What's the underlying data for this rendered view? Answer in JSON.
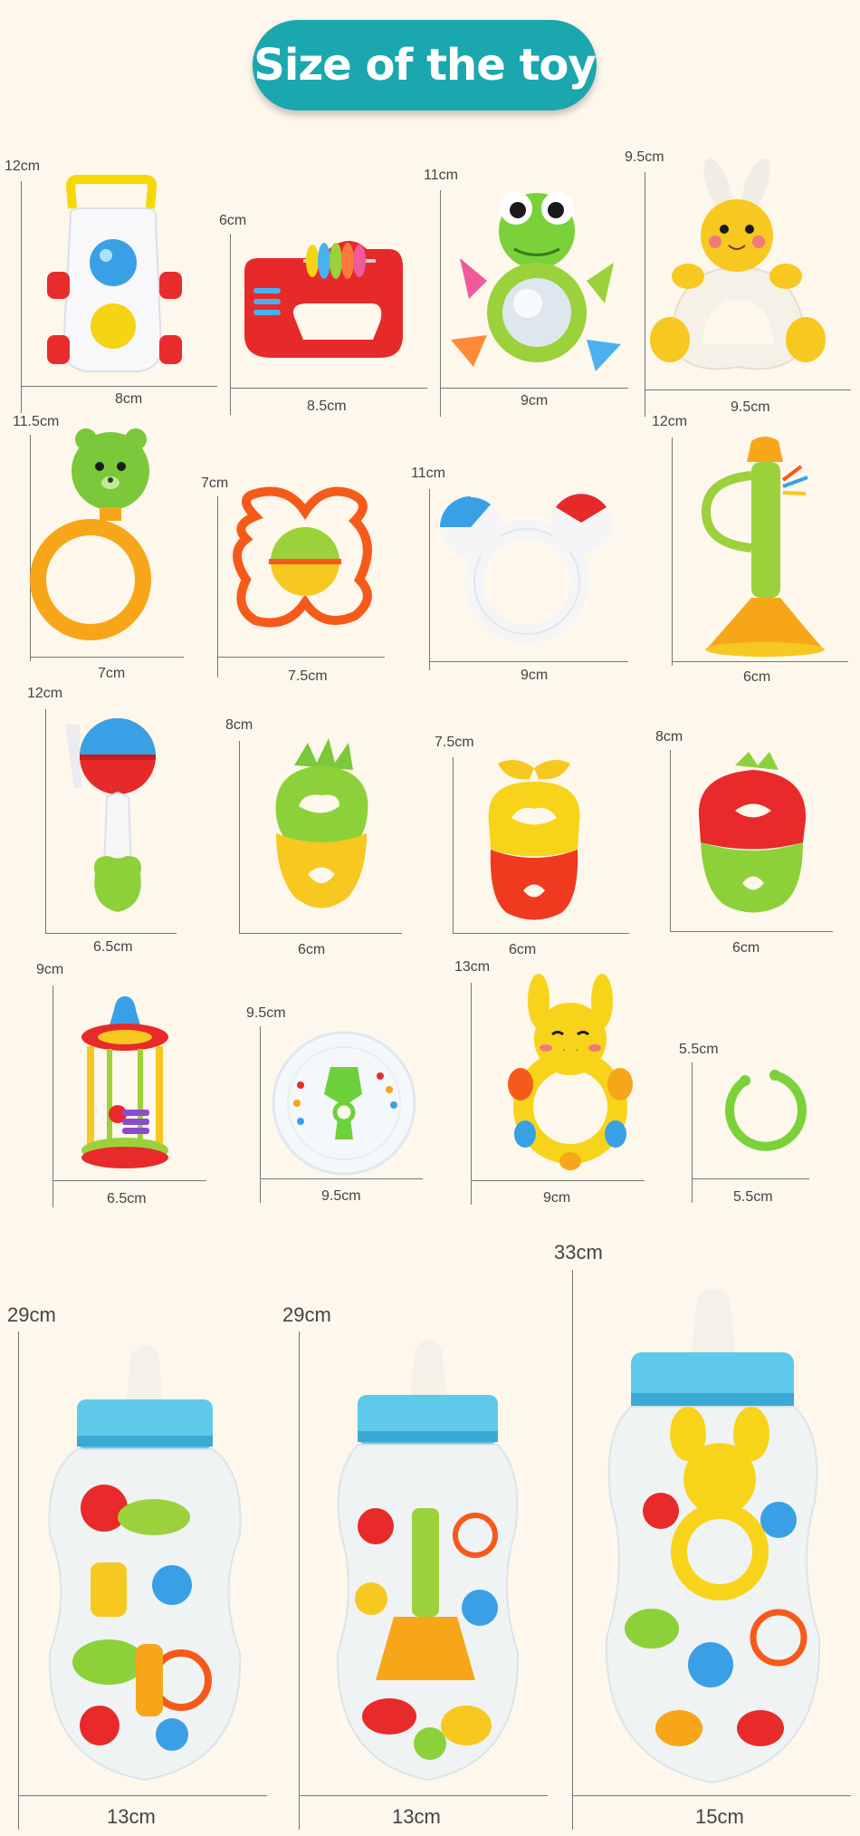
{
  "title": "Size of the toy",
  "colors": {
    "background": "#fdf7ec",
    "title_pill": "#1aa7ae",
    "title_text": "#ffffff",
    "dimension_line": "#777777"
  },
  "toys": [
    {
      "name": "car rattle",
      "icon": "car-rattle-icon",
      "height": "12cm",
      "width": "8cm"
    },
    {
      "name": "bead handle rattle",
      "icon": "bead-rattle-icon",
      "height": "6cm",
      "width": "8.5cm"
    },
    {
      "name": "frog mirror rattle",
      "icon": "frog-rattle-icon",
      "height": "11cm",
      "width": "9cm"
    },
    {
      "name": "bunny teether ring",
      "icon": "bunny-teether-icon",
      "height": "9.5cm",
      "width": "9.5cm"
    },
    {
      "name": "bear ring rattle",
      "icon": "bear-ring-icon",
      "height": "11.5cm",
      "width": "7cm"
    },
    {
      "name": "flower ring rattle",
      "icon": "flower-ring-icon",
      "height": "7cm",
      "width": "7.5cm"
    },
    {
      "name": "mouse ring rattle",
      "icon": "mouse-ring-icon",
      "height": "11cm",
      "width": "9cm"
    },
    {
      "name": "trumpet rattle",
      "icon": "trumpet-icon",
      "height": "12cm",
      "width": "6cm"
    },
    {
      "name": "dumbbell rattle",
      "icon": "dumbbell-rattle-icon",
      "height": "12cm",
      "width": "6.5cm"
    },
    {
      "name": "pineapple teether",
      "icon": "pineapple-teether-icon",
      "height": "8cm",
      "width": "6cm"
    },
    {
      "name": "apple teether",
      "icon": "apple-teether-icon",
      "height": "7.5cm",
      "width": "6cm"
    },
    {
      "name": "strawberry teether",
      "icon": "strawberry-teether-icon",
      "height": "8cm",
      "width": "6cm"
    },
    {
      "name": "cage roller rattle",
      "icon": "roller-rattle-icon",
      "height": "9cm",
      "width": "6.5cm"
    },
    {
      "name": "clear bead ball",
      "icon": "bead-ball-icon",
      "height": "9.5cm",
      "width": "9.5cm"
    },
    {
      "name": "bunny bell rattle",
      "icon": "bunny-bell-icon",
      "height": "13cm",
      "width": "9cm"
    },
    {
      "name": "link ring",
      "icon": "link-ring-icon",
      "height": "5.5cm",
      "width": "5.5cm"
    }
  ],
  "bottles": [
    {
      "name": "small bottle",
      "icon": "bottle-icon",
      "height": "29cm",
      "width": "13cm"
    },
    {
      "name": "medium bottle",
      "icon": "bottle-icon",
      "height": "29cm",
      "width": "13cm"
    },
    {
      "name": "large bottle",
      "icon": "bottle-icon",
      "height": "33cm",
      "width": "15cm"
    }
  ]
}
